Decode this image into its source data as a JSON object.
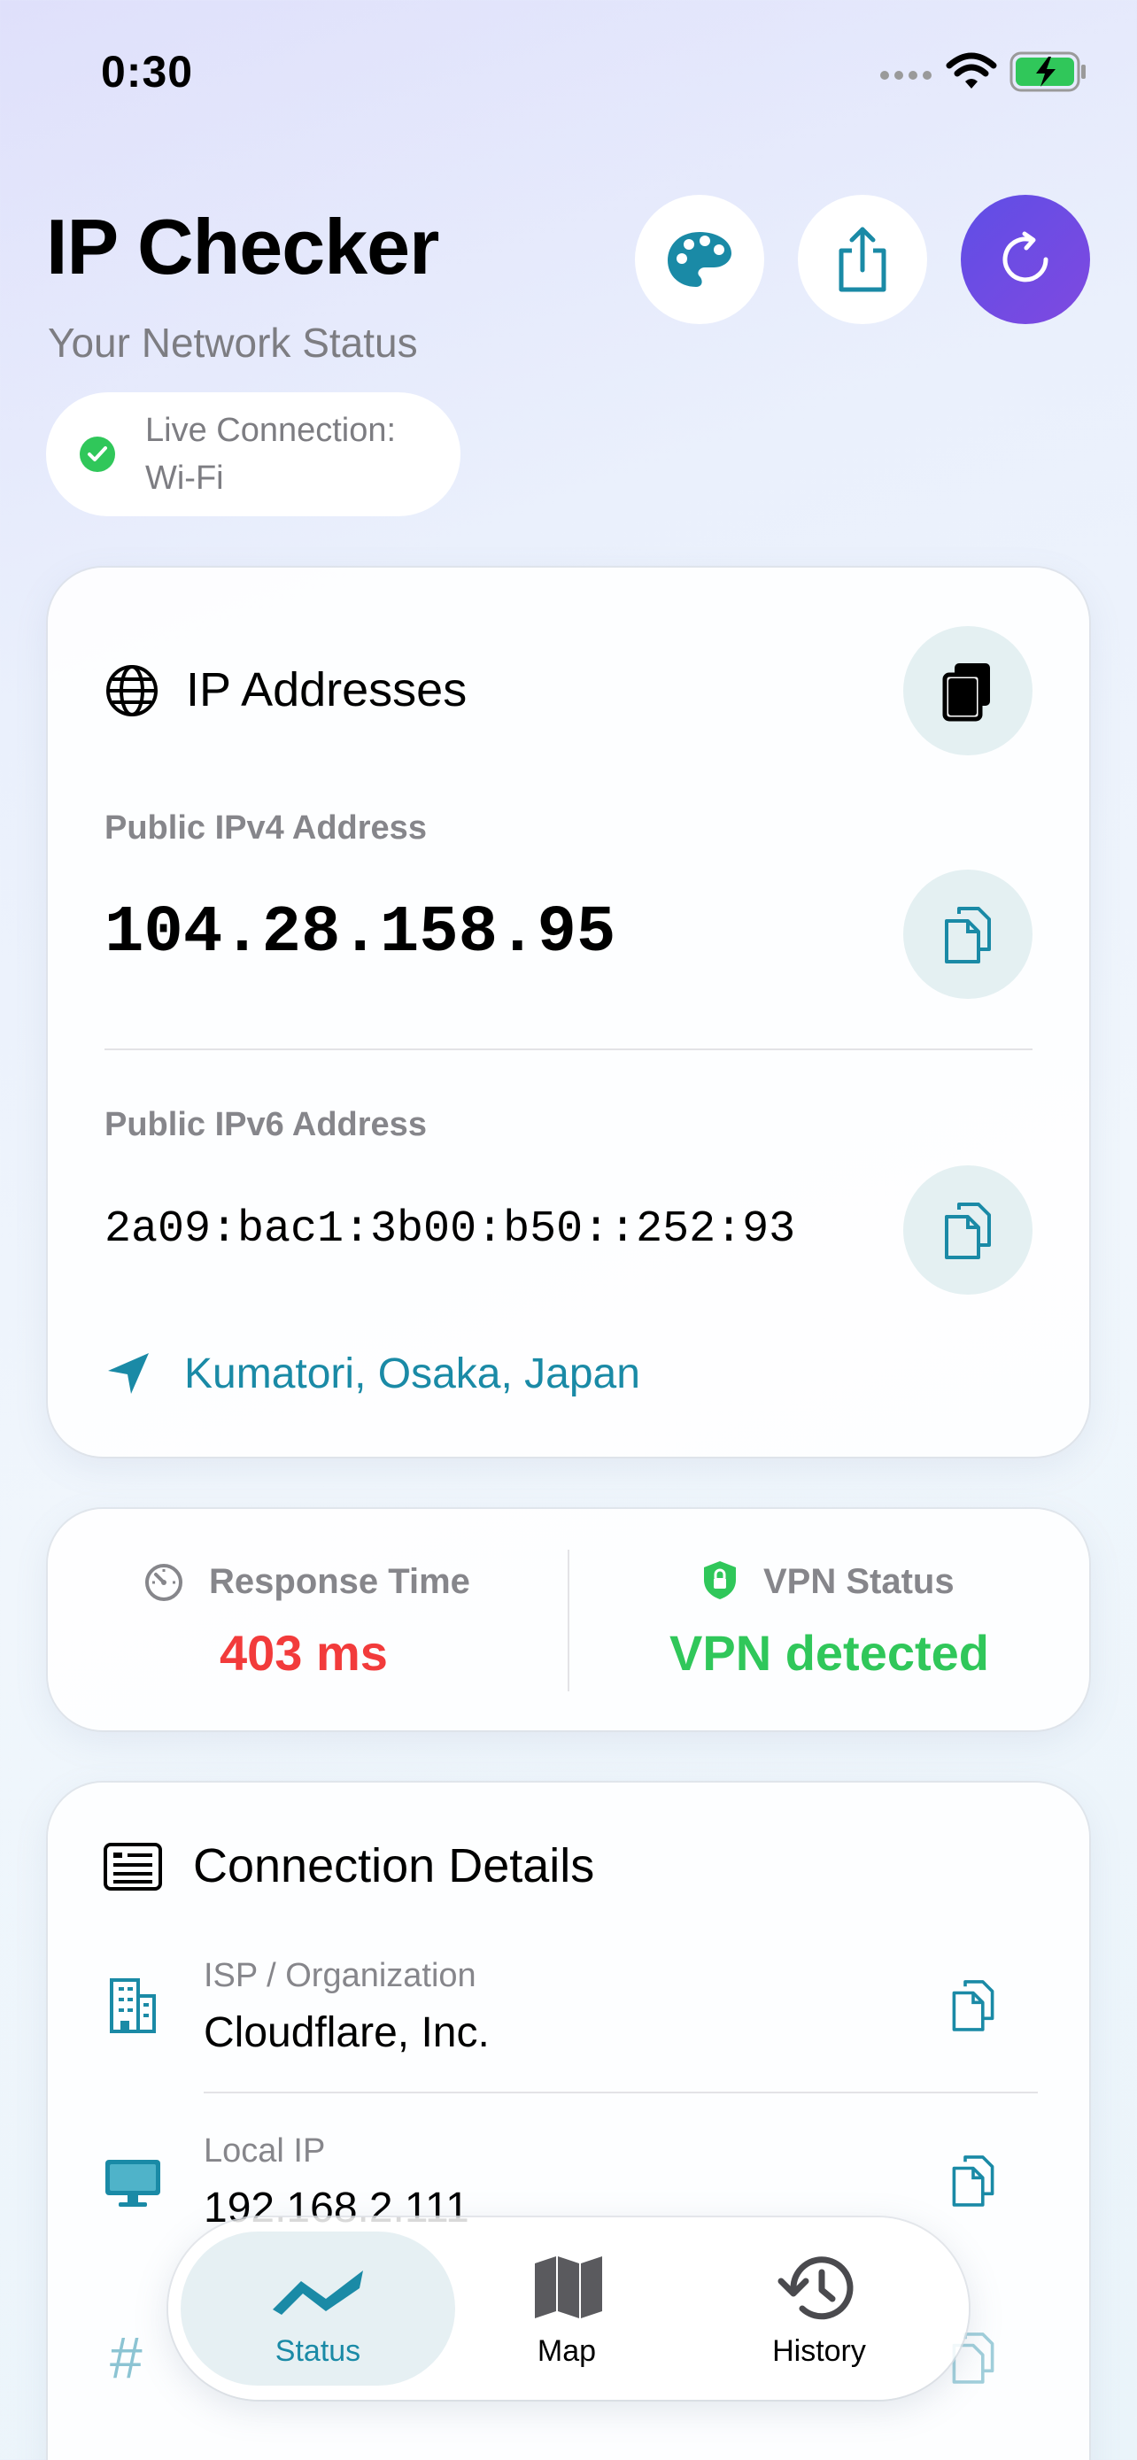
{
  "status_bar": {
    "time": "0:30"
  },
  "header": {
    "title": "IP Checker",
    "subtitle": "Your Network Status",
    "live_connection": "Live Connection: Wi-Fi",
    "buttons": {
      "palette": "palette-icon",
      "share": "share-icon",
      "refresh": "refresh-icon"
    }
  },
  "ip_card": {
    "title": "IP Addresses",
    "ipv4_label": "Public IPv4 Address",
    "ipv4": "104.28.158.95",
    "ipv6_label": "Public IPv6 Address",
    "ipv6": "2a09:bac1:3b00:b50::252:93",
    "location": "Kumatori, Osaka, Japan"
  },
  "stats": {
    "response_label": "Response Time",
    "response_value": "403 ms",
    "vpn_label": "VPN Status",
    "vpn_value": "VPN detected"
  },
  "connection": {
    "title": "Connection Details",
    "rows": [
      {
        "label": "ISP / Organization",
        "value": "Cloudflare, Inc."
      },
      {
        "label": "Local IP",
        "value": "192.168.2.111"
      }
    ]
  },
  "tabs": [
    {
      "label": "Status",
      "active": true
    },
    {
      "label": "Map",
      "active": false
    },
    {
      "label": "History",
      "active": false
    }
  ],
  "colors": {
    "accent": "#1a8aa6",
    "refresh_gradient": "#5f4ee6",
    "response_red": "#f23b3b",
    "vpn_green": "#30c75a"
  }
}
